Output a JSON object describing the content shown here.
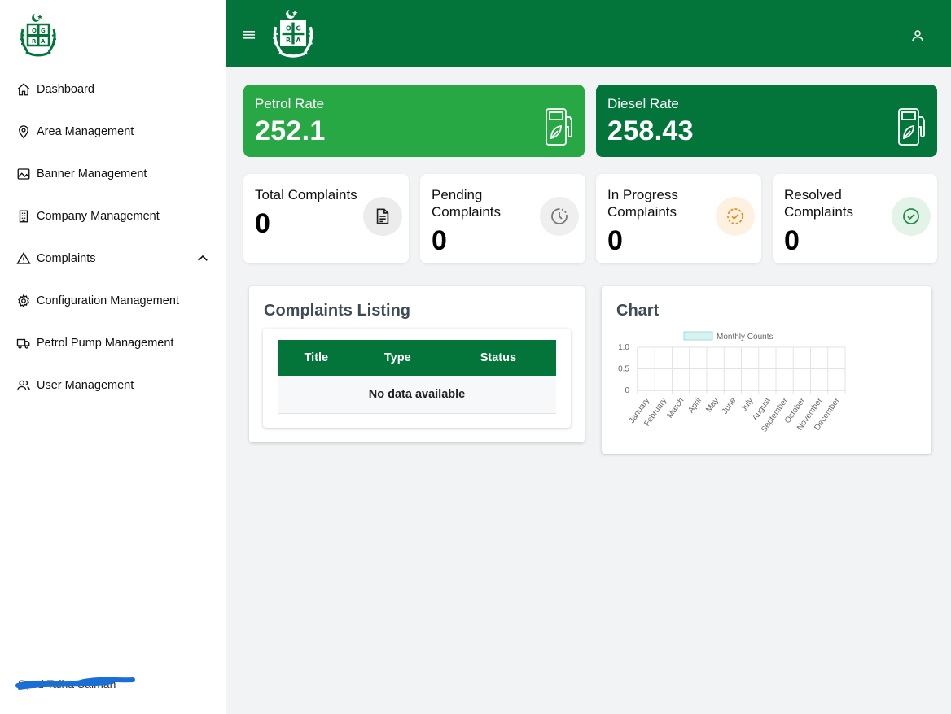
{
  "sidebar": {
    "items": [
      {
        "label": "Dashboard",
        "icon": "home-icon"
      },
      {
        "label": "Area Management",
        "icon": "location-pin-icon"
      },
      {
        "label": "Banner Management",
        "icon": "image-icon"
      },
      {
        "label": "Company Management",
        "icon": "building-icon"
      },
      {
        "label": "Complaints",
        "icon": "warning-icon"
      },
      {
        "label": "Configuration Management",
        "icon": "gear-icon"
      },
      {
        "label": "Petrol Pump Management",
        "icon": "truck-icon"
      },
      {
        "label": "User Management",
        "icon": "users-icon"
      }
    ],
    "user_name": "Syed Talha Salman"
  },
  "rates": {
    "petrol": {
      "label": "Petrol Rate",
      "value": "252.1"
    },
    "diesel": {
      "label": "Diesel Rate",
      "value": "258.43"
    }
  },
  "stats": {
    "total": {
      "label": "Total Complaints",
      "value": "0"
    },
    "pending": {
      "label": "Pending Complaints",
      "value": "0"
    },
    "in_progress": {
      "label": "In Progress Complaints",
      "value": "0"
    },
    "resolved": {
      "label": "Resolved Complaints",
      "value": "0"
    }
  },
  "listing": {
    "title": "Complaints Listing",
    "columns": [
      "Title",
      "Type",
      "Status"
    ],
    "empty_text": "No data available"
  },
  "colors": {
    "primary": "#04753a",
    "petrol_card": "#28a745",
    "progress_icon": "#e8901a",
    "resolved_icon": "#1e8e4a"
  },
  "chart_data": {
    "title": "Chart",
    "type": "bar",
    "categories": [
      "January",
      "February",
      "March",
      "April",
      "May",
      "June",
      "July",
      "August",
      "September",
      "October",
      "November",
      "December"
    ],
    "series": [
      {
        "name": "Monthly Counts",
        "values": [
          0,
          0,
          0,
          0,
          0,
          0,
          0,
          0,
          0,
          0,
          0,
          0
        ],
        "color": "#9fdcd8"
      }
    ],
    "ylim": [
      0,
      1.0
    ],
    "yticks": [
      "1.0",
      "0.5",
      "0"
    ],
    "grid": true,
    "legend": "top"
  }
}
